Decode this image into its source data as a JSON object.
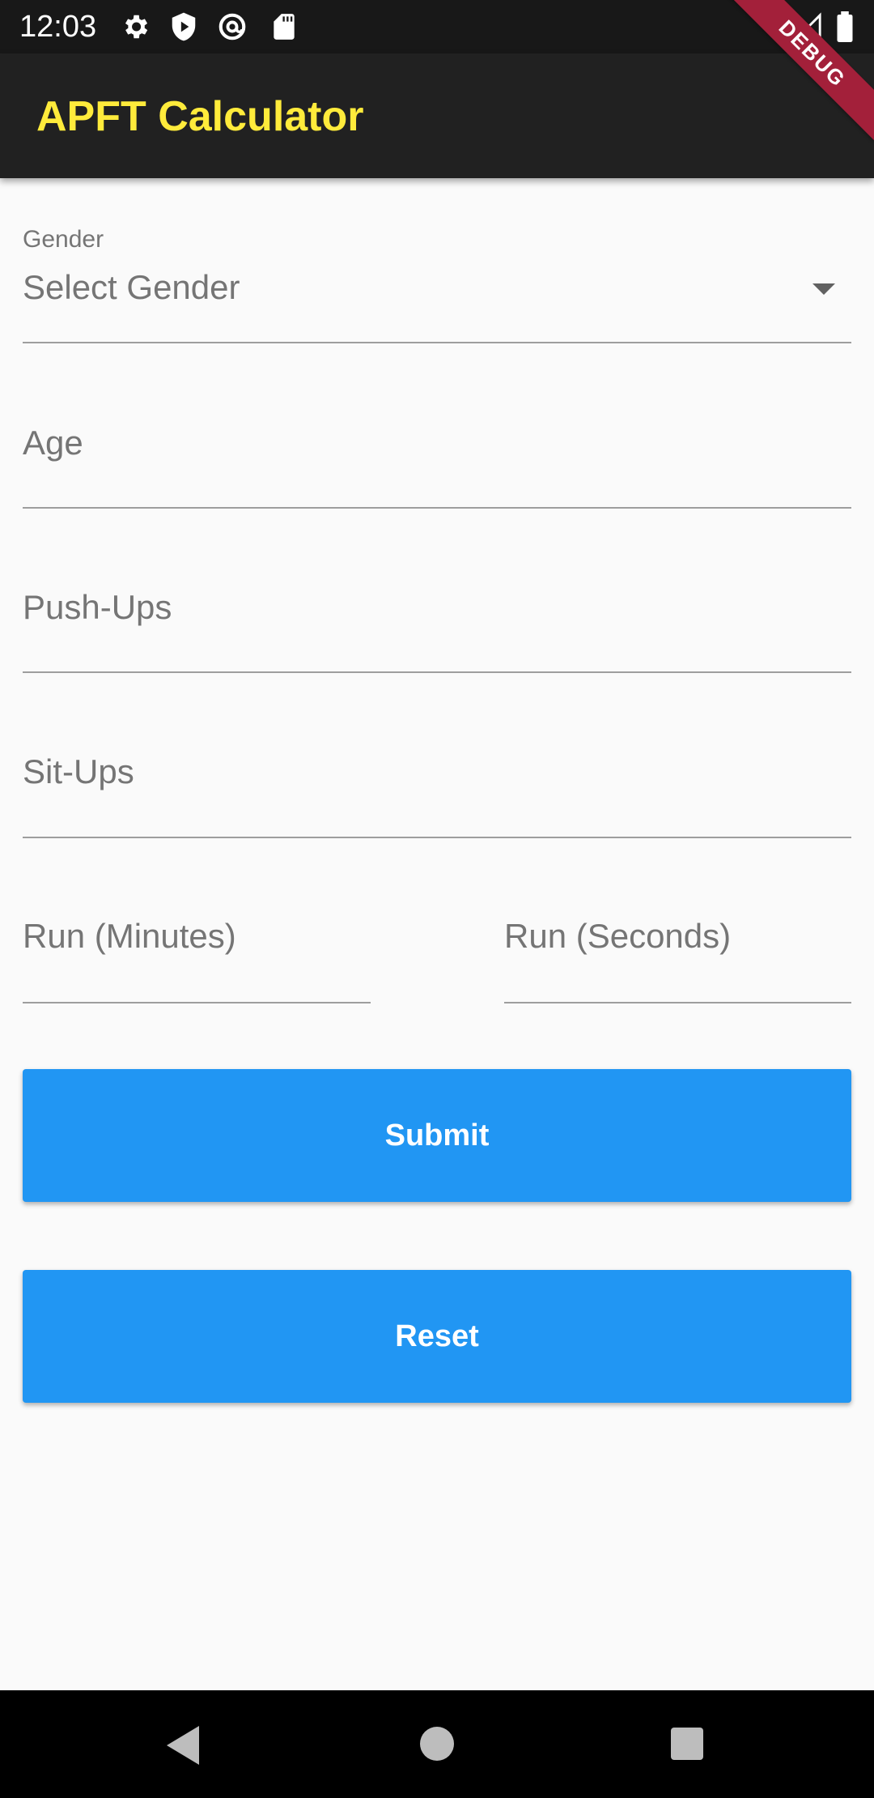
{
  "status_bar": {
    "time": "12:03",
    "icons": [
      "settings-icon",
      "shield-play-icon",
      "at-sign-icon",
      "sd-card-icon",
      "wifi-icon",
      "signal-icon",
      "battery-icon"
    ]
  },
  "debug_banner": "DEBUG",
  "app_bar": {
    "title": "APFT Calculator",
    "title_color": "#ffeb3b",
    "background": "#212121"
  },
  "form": {
    "gender": {
      "label": "Gender",
      "value": "Select Gender"
    },
    "age": {
      "placeholder": "Age"
    },
    "pushups": {
      "placeholder": "Push-Ups"
    },
    "situps": {
      "placeholder": "Sit-Ups"
    },
    "run_minutes": {
      "placeholder": "Run (Minutes)"
    },
    "run_seconds": {
      "placeholder": "Run (Seconds)"
    }
  },
  "buttons": {
    "submit": "Submit",
    "reset": "Reset",
    "color": "#2196f3"
  },
  "nav_bar": {
    "icons": [
      "back-icon",
      "home-icon",
      "recents-icon"
    ]
  }
}
